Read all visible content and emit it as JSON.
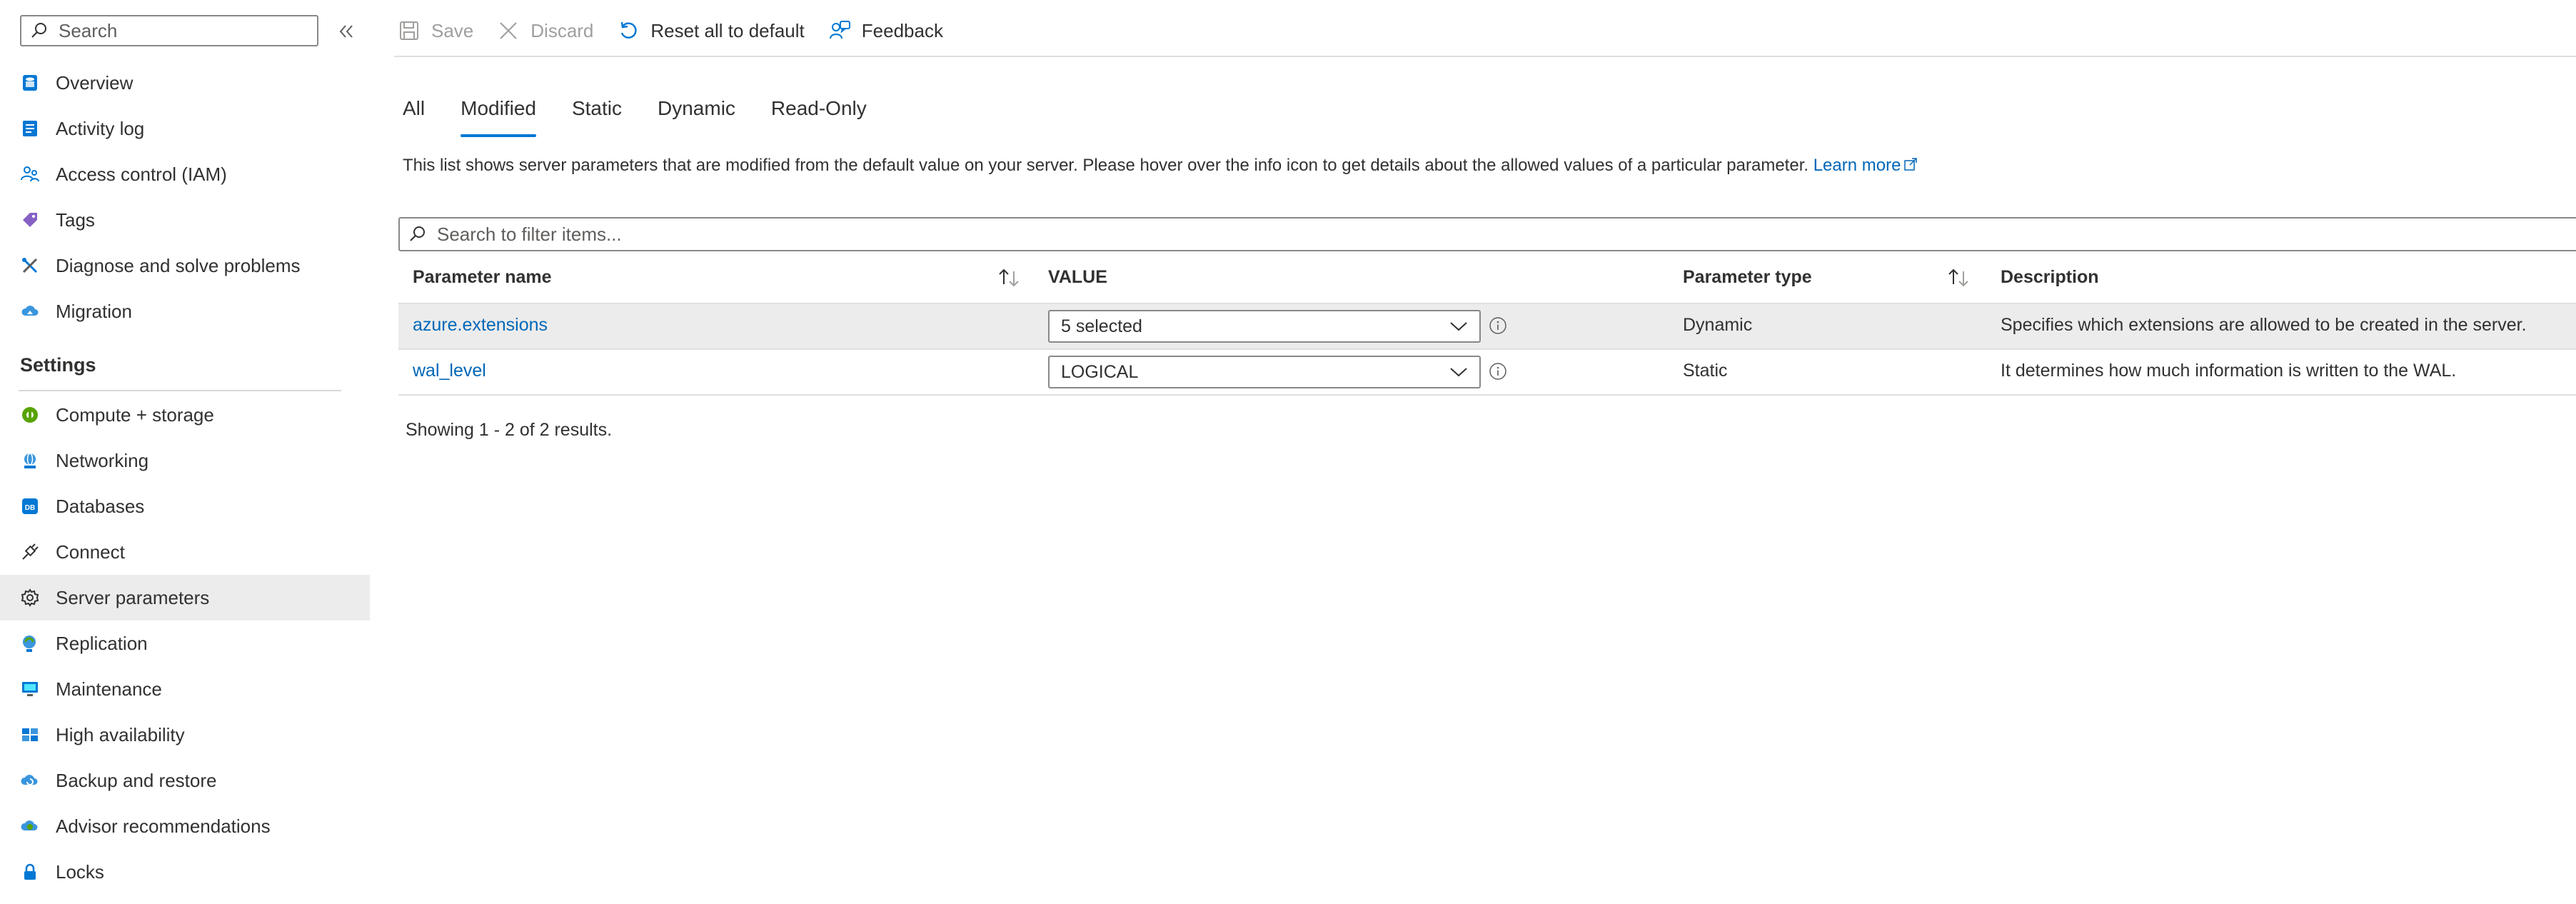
{
  "sidebar": {
    "search_placeholder": "Search",
    "items_top": [
      {
        "label": "Overview",
        "icon": "database-overview-icon"
      },
      {
        "label": "Activity log",
        "icon": "activity-log-icon"
      },
      {
        "label": "Access control (IAM)",
        "icon": "people-icon"
      },
      {
        "label": "Tags",
        "icon": "tag-icon"
      },
      {
        "label": "Diagnose and solve problems",
        "icon": "wrench-icon"
      },
      {
        "label": "Migration",
        "icon": "cloud-migration-icon"
      }
    ],
    "settings_heading": "Settings",
    "items_settings": [
      {
        "label": "Compute + storage",
        "icon": "compute-icon"
      },
      {
        "label": "Networking",
        "icon": "globe-network-icon"
      },
      {
        "label": "Databases",
        "icon": "database-icon"
      },
      {
        "label": "Connect",
        "icon": "plug-icon"
      },
      {
        "label": "Server parameters",
        "icon": "gear-icon",
        "selected": true
      },
      {
        "label": "Replication",
        "icon": "replication-icon"
      },
      {
        "label": "Maintenance",
        "icon": "monitor-icon"
      },
      {
        "label": "High availability",
        "icon": "high-availability-icon"
      },
      {
        "label": "Backup and restore",
        "icon": "cloud-backup-icon"
      },
      {
        "label": "Advisor recommendations",
        "icon": "advisor-icon"
      },
      {
        "label": "Locks",
        "icon": "lock-icon"
      }
    ]
  },
  "toolbar": {
    "save_label": "Save",
    "discard_label": "Discard",
    "reset_label": "Reset all to default",
    "feedback_label": "Feedback"
  },
  "tabs": [
    {
      "label": "All"
    },
    {
      "label": "Modified",
      "active": true
    },
    {
      "label": "Static"
    },
    {
      "label": "Dynamic"
    },
    {
      "label": "Read-Only"
    }
  ],
  "info": {
    "text": "This list shows server parameters that are modified from the default value on your server. Please hover over the info icon to get details about the allowed values of a particular parameter.",
    "learn_more": "Learn more"
  },
  "filter": {
    "placeholder": "Search to filter items..."
  },
  "grid": {
    "headers": {
      "name": "Parameter name",
      "value": "VALUE",
      "type": "Parameter type",
      "description": "Description"
    },
    "rows": [
      {
        "name": "azure.extensions",
        "value": "5 selected",
        "type": "Dynamic",
        "description": "Specifies which extensions are allowed to be created in the server."
      },
      {
        "name": "wal_level",
        "value": "LOGICAL",
        "type": "Static",
        "description": "It determines how much information is written to the WAL."
      }
    ]
  },
  "results_text": "Showing 1 - 2 of 2 results.",
  "colors": {
    "accent": "#0078d4",
    "link": "#0067b8",
    "selected_bg": "#ececec"
  }
}
